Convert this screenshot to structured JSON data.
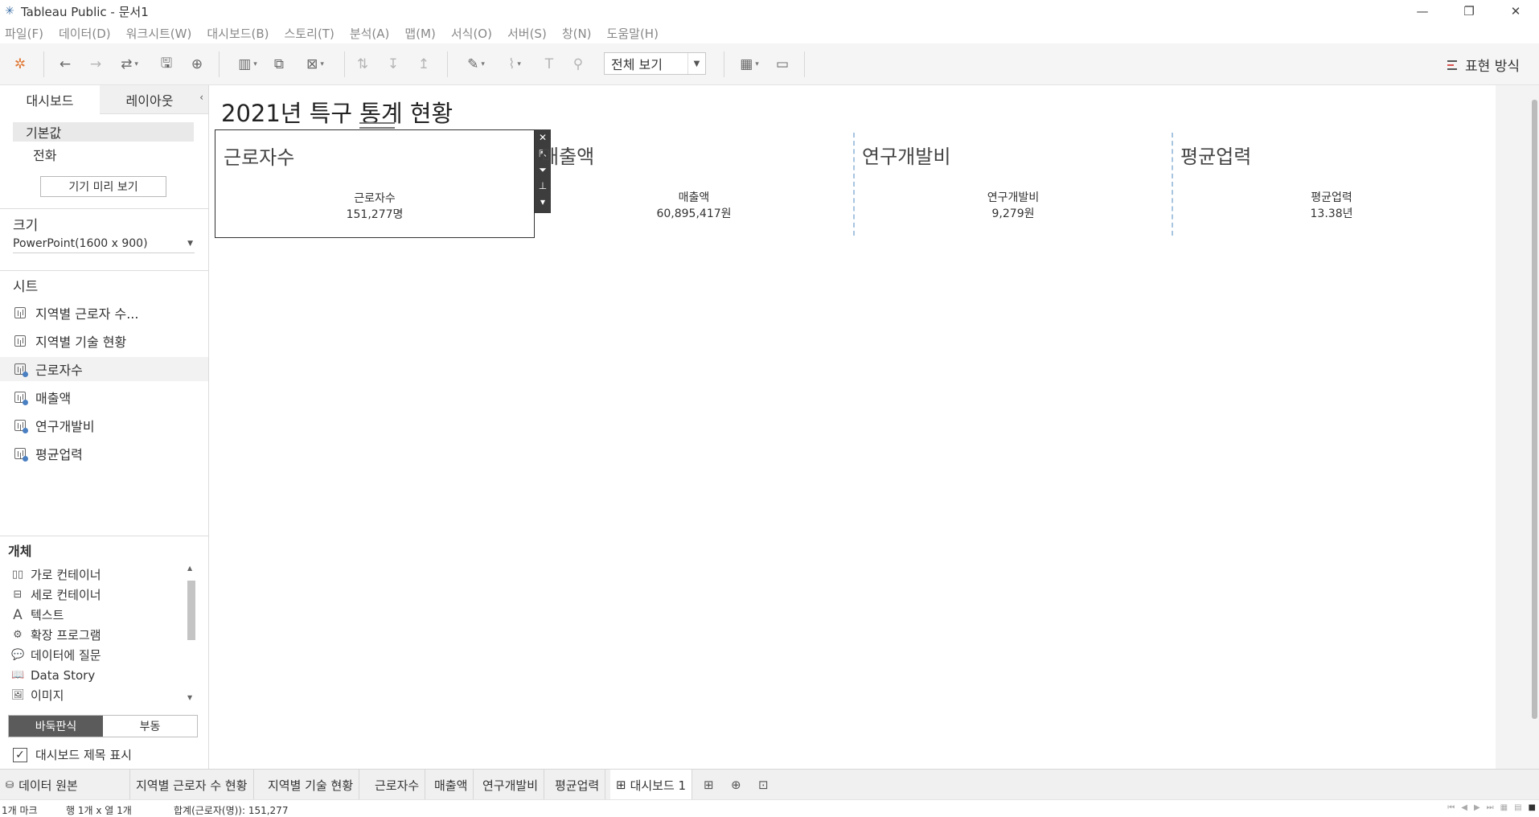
{
  "window": {
    "title": "Tableau Public - 문서1",
    "controls": [
      "—",
      "❐",
      "✕"
    ]
  },
  "menu": [
    "파일(F)",
    "데이터(D)",
    "워크시트(W)",
    "대시보드(B)",
    "스토리(T)",
    "분석(A)",
    "맵(M)",
    "서식(O)",
    "서버(S)",
    "창(N)",
    "도움말(H)"
  ],
  "toolbar": {
    "fit_value": "전체 보기",
    "show_me": "표현 방식"
  },
  "left_panel": {
    "tabs": [
      "대시보드",
      "레이아웃"
    ],
    "devices": [
      "기본값",
      "전화"
    ],
    "preview_button": "기기 미리 보기",
    "size_heading": "크기",
    "size_value": "PowerPoint(1600 x 900)",
    "sheets_heading": "시트",
    "sheets": [
      "지역별 근로자 수...",
      "지역별 기술 현황",
      "근로자수",
      "매출액",
      "연구개발비",
      "평균업력"
    ],
    "objects_heading": "개체",
    "objects": [
      {
        "icon": "horizontal-container-icon",
        "label": "가로 컨테이너"
      },
      {
        "icon": "vertical-container-icon",
        "label": "세로 컨테이너"
      },
      {
        "icon": "text-icon",
        "label": "텍스트"
      },
      {
        "icon": "extension-icon",
        "label": "확장 프로그램"
      },
      {
        "icon": "ask-data-icon",
        "label": "데이터에 질문"
      },
      {
        "icon": "book-icon",
        "label": "Data Story"
      },
      {
        "icon": "image-icon",
        "label": "이미지"
      }
    ],
    "layout_modes": [
      "바둑판식",
      "부동"
    ],
    "show_title_label": "대시보드 제목 표시",
    "show_title_checked": true
  },
  "dashboard": {
    "title": "2021년 특구 통계 현황",
    "tiles": [
      {
        "title": "근로자수",
        "label": "근로자수",
        "value": "151,277명"
      },
      {
        "title": "매출액",
        "label": "매출액",
        "value": "60,895,417원"
      },
      {
        "title": "연구개발비",
        "label": "연구개발비",
        "value": "9,279원"
      },
      {
        "title": "평균업력",
        "label": "평균업력",
        "value": "13.38년"
      }
    ]
  },
  "sheet_tabs": [
    "데이터 원본",
    "지역별 근로자 수 현황",
    "지역별 기술 현황",
    "근로자수",
    "매출액",
    "연구개발비",
    "평균업력",
    "대시보드 1"
  ],
  "active_sheet_tab": "대시보드 1",
  "status": {
    "marks": "1개 마크",
    "rows_cols": "행 1개  x  열 1개",
    "sum": "합계(근로자(명)): 151,277"
  }
}
